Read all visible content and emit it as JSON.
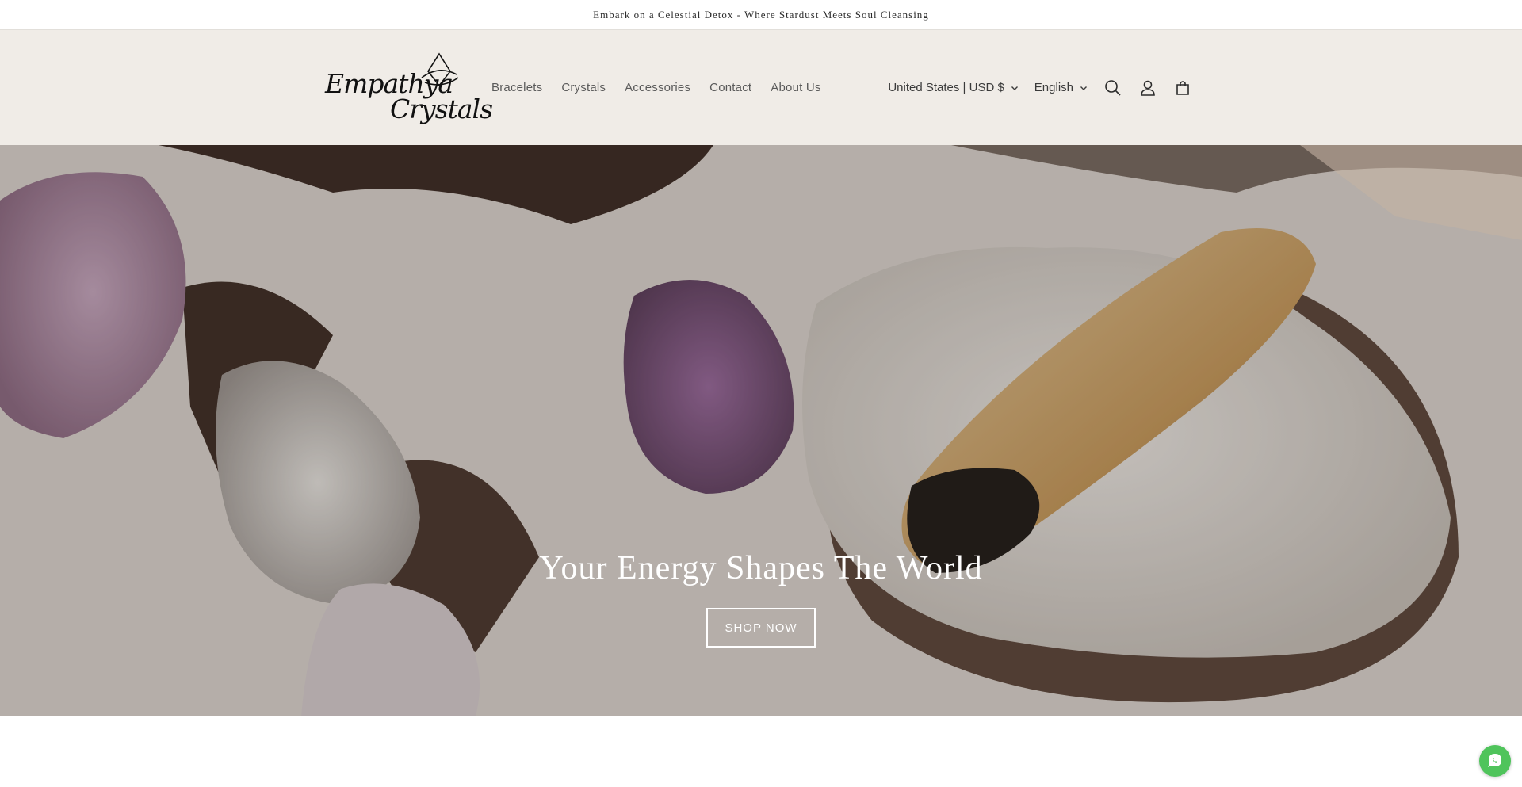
{
  "announcement": {
    "text": "Embark on a Celestial Detox - Where Stardust Meets Soul Cleansing"
  },
  "logo": {
    "line1": "Empathya",
    "line2": "Crystals"
  },
  "nav": {
    "items": [
      "Bracelets",
      "Crystals",
      "Accessories",
      "Contact",
      "About Us"
    ]
  },
  "header": {
    "country_currency": "United States | USD $",
    "language": "English",
    "icons": [
      "search-icon",
      "account-icon",
      "cart-icon",
      "chevron-down-icon"
    ]
  },
  "hero": {
    "title": "Your Energy Shapes The World",
    "cta_label": "SHOP NOW"
  },
  "floating": {
    "icon": "whatsapp-icon"
  },
  "colors": {
    "header_bg": "#f0ece7",
    "announcement_bg": "#ffffff",
    "nav_text": "#5a5a5a",
    "whatsapp_green": "#4fc45b"
  }
}
